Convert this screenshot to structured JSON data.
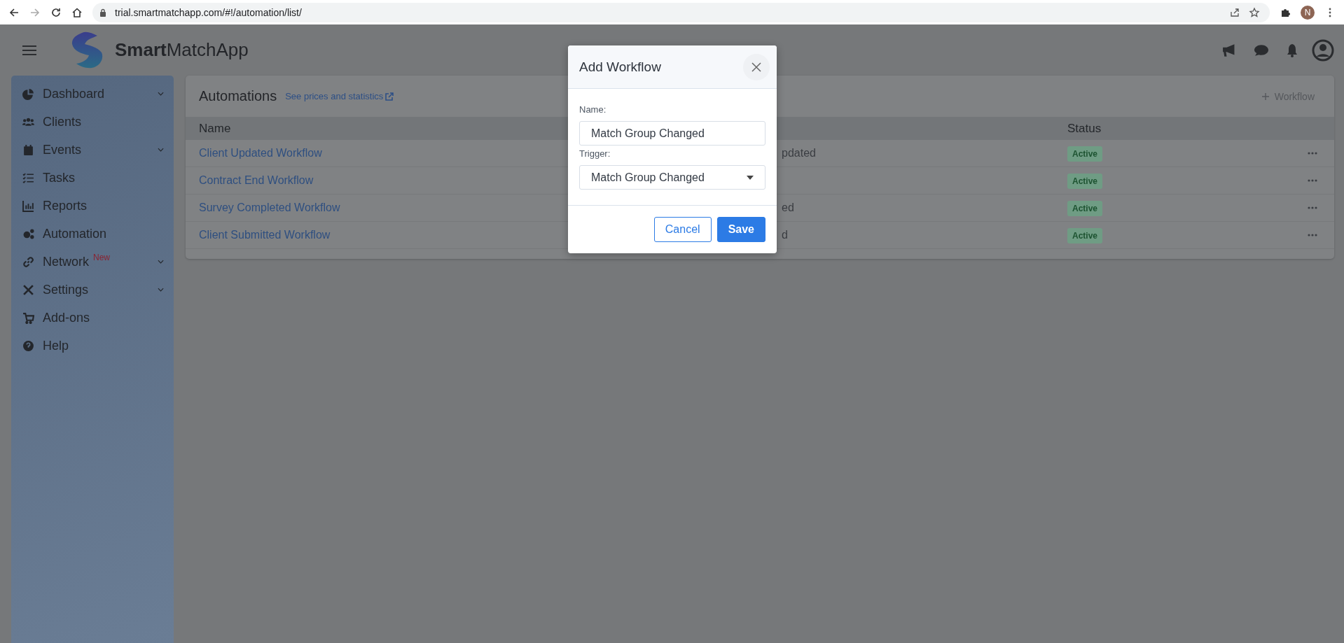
{
  "browser": {
    "url": "trial.smartmatchapp.com/#!/automation/list/",
    "profile_initial": "N"
  },
  "header": {
    "logo_text": "**Smart**MatchApp"
  },
  "sidebar": {
    "items": [
      {
        "label": "Dashboard",
        "expandable": true
      },
      {
        "label": "Clients",
        "expandable": false
      },
      {
        "label": "Events",
        "expandable": true
      },
      {
        "label": "Tasks",
        "expandable": false
      },
      {
        "label": "Reports",
        "expandable": false
      },
      {
        "label": "Automation",
        "expandable": false
      },
      {
        "label": "Network",
        "badge": "New",
        "expandable": true
      },
      {
        "label": "Settings",
        "expandable": true
      },
      {
        "label": "Add-ons",
        "expandable": false
      },
      {
        "label": "Help",
        "expandable": false
      }
    ]
  },
  "card": {
    "title": "Automations",
    "link": "See prices and statistics",
    "add_button": "Workflow",
    "table": {
      "columns": [
        {
          "label": "Name"
        },
        {
          "label": "Status"
        }
      ],
      "rows": [
        {
          "name": "Client Updated Workflow",
          "column_2": "pdated",
          "status": "Active"
        },
        {
          "name": "Contract End Workflow",
          "status": "Active"
        },
        {
          "name": "Survey Completed Workflow",
          "column_2": "ed",
          "status": "Active"
        },
        {
          "name": "Client Submitted Workflow",
          "column_2": "d",
          "status": "Active"
        }
      ]
    }
  },
  "modal": {
    "title": "Add Workflow",
    "name_label": "Name:",
    "name_value": "Match Group Changed",
    "trigger_label": "Trigger:",
    "trigger_value": "Match Group Changed",
    "cancel": "Cancel",
    "save": "Save"
  }
}
